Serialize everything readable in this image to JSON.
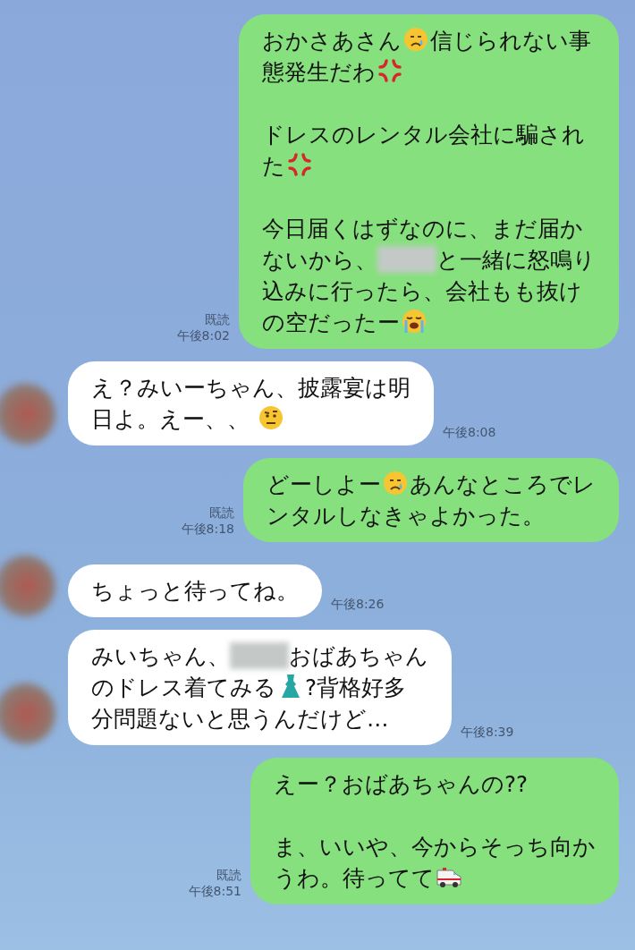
{
  "messages": [
    {
      "kind": "sent",
      "read": "既読",
      "time": "午後8:02",
      "paragraphs": [
        [
          [
            {
              "kind": "text",
              "text": "おかさあさん"
            },
            {
              "kind": "crying-face"
            },
            {
              "kind": "text",
              "text": "信じられない事"
            }
          ],
          [
            {
              "kind": "text",
              "text": "態発生だわ"
            },
            {
              "kind": "anger"
            }
          ]
        ],
        [
          [
            {
              "kind": "text",
              "text": "ドレスのレンタル会社に騙され"
            }
          ],
          [
            {
              "kind": "text",
              "text": "た"
            },
            {
              "kind": "anger"
            }
          ]
        ],
        [
          [
            {
              "kind": "text",
              "text": "今日届くはずなのに、まだ届か"
            }
          ],
          [
            {
              "kind": "text",
              "text": "ないから、"
            },
            {
              "kind": "redacted"
            },
            {
              "kind": "text",
              "text": "と一緒に怒鳴り"
            }
          ],
          [
            {
              "kind": "text",
              "text": "込みに行ったら、会社もも抜け"
            }
          ],
          [
            {
              "kind": "text",
              "text": "の空だったー"
            },
            {
              "kind": "sobbing-face"
            }
          ]
        ]
      ]
    },
    {
      "kind": "received",
      "time": "午後8:08",
      "paragraphs": [
        [
          [
            {
              "kind": "text",
              "text": "え？みいーちゃん、披露宴は明"
            }
          ],
          [
            {
              "kind": "text",
              "text": "日よ。えー、、 "
            },
            {
              "kind": "doubtful-face"
            }
          ]
        ]
      ]
    },
    {
      "kind": "sent",
      "read": "既読",
      "time": "午後8:18",
      "paragraphs": [
        [
          [
            {
              "kind": "text",
              "text": "どーしよー"
            },
            {
              "kind": "crying-face"
            },
            {
              "kind": "text",
              "text": "あんなところでレ"
            }
          ],
          [
            {
              "kind": "text",
              "text": "ンタルしなきゃよかった。"
            }
          ]
        ]
      ]
    },
    {
      "kind": "received",
      "time": "午後8:26",
      "paragraphs": [
        [
          [
            {
              "kind": "text",
              "text": "ちょっと待ってね。"
            }
          ]
        ]
      ]
    },
    {
      "kind": "received",
      "time": "午後8:39",
      "paragraphs": [
        [
          [
            {
              "kind": "text",
              "text": "みいちゃん、"
            },
            {
              "kind": "redacted"
            },
            {
              "kind": "text",
              "text": "おばあちゃん"
            }
          ],
          [
            {
              "kind": "text",
              "text": "のドレス着てみる"
            },
            {
              "kind": "dress"
            },
            {
              "kind": "text",
              "text": "?背格好多"
            }
          ],
          [
            {
              "kind": "text",
              "text": "分問題ないと思うんだけど…"
            }
          ]
        ]
      ]
    },
    {
      "kind": "sent",
      "read": "既読",
      "time": "午後8:51",
      "paragraphs": [
        [
          [
            {
              "kind": "text",
              "text": "えー？おばあちゃんの??"
            }
          ]
        ],
        [
          [
            {
              "kind": "text",
              "text": "ま、いいや、今からそっち向か"
            }
          ],
          [
            {
              "kind": "text",
              "text": "うわ。待ってて"
            },
            {
              "kind": "ambulance"
            }
          ]
        ]
      ]
    }
  ]
}
